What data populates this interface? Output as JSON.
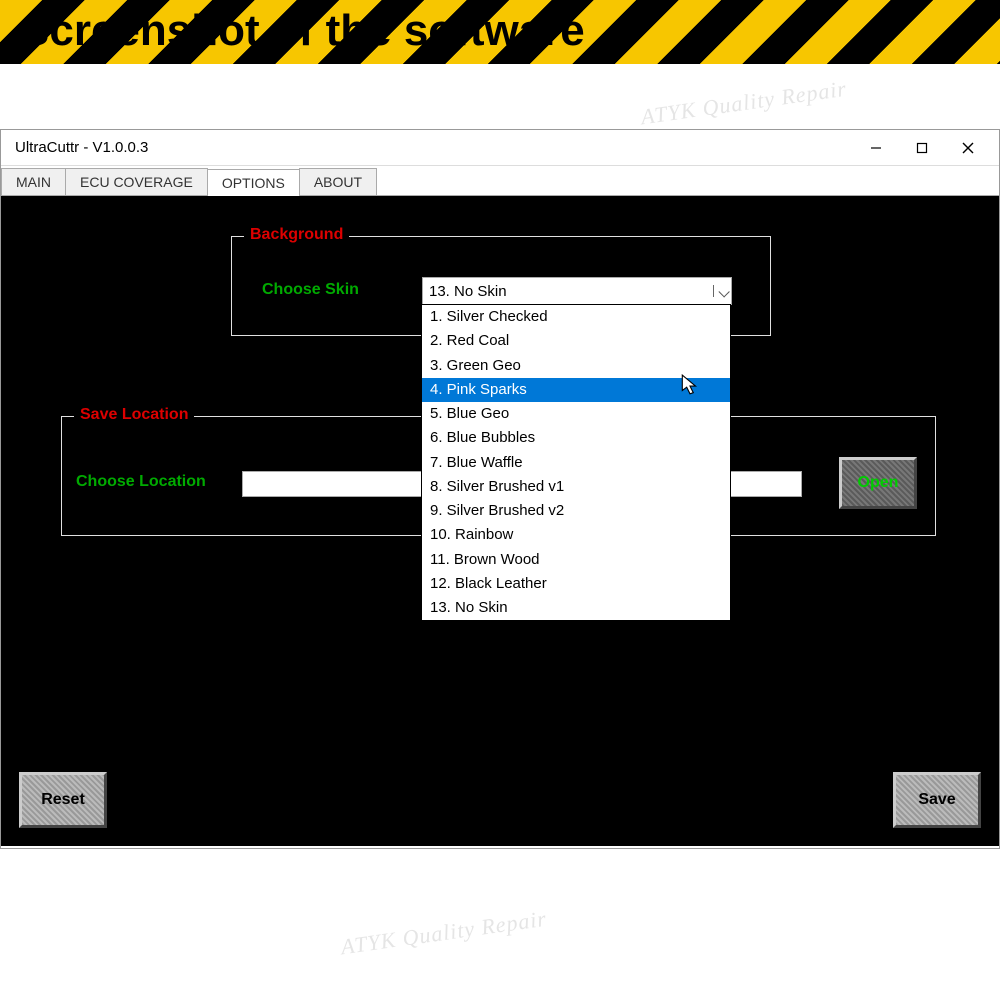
{
  "page_caption": "Screenshot of the software",
  "watermark_text": "ATYK Quality Repair",
  "window": {
    "title": "UltraCuttr - V1.0.0.3"
  },
  "tabs": [
    "MAIN",
    "ECU COVERAGE",
    "OPTIONS",
    "ABOUT"
  ],
  "active_tab": "OPTIONS",
  "background_group": {
    "legend": "Background",
    "label": "Choose Skin",
    "selected": "13. No Skin"
  },
  "skin_options": [
    "1. Silver Checked",
    "2. Red Coal",
    "3. Green Geo",
    "4. Pink Sparks",
    "5. Blue Geo",
    "6. Blue Bubbles",
    "7. Blue Waffle",
    "8. Silver Brushed v1",
    "9. Silver Brushed v2",
    "10. Rainbow",
    "11. Brown Wood",
    "12. Black Leather",
    "13. No Skin"
  ],
  "highlighted_option_index": 3,
  "save_location_group": {
    "legend": "Save Location",
    "label": "Choose Location",
    "value": ""
  },
  "buttons": {
    "open": "Open",
    "reset": "Reset",
    "save": "Save"
  }
}
